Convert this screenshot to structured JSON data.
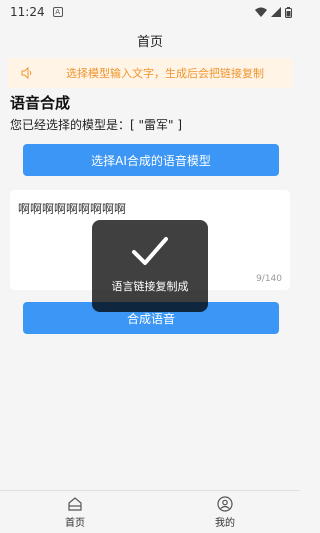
{
  "status_bar": {
    "time": "11:24",
    "notif_glyph": "A"
  },
  "nav": {
    "title": "首页"
  },
  "notice": {
    "icon": "speaker-icon",
    "text": "选择模型输入文字，生成后会把链接复制"
  },
  "main": {
    "title": "语音合成",
    "model_line": "您已经选择的模型是：[ \"雷军\" ]",
    "select_button": "选择AI合成的语音模型",
    "text_input": {
      "value": "啊啊啊啊啊啊啊啊啊",
      "counter": "9/140"
    },
    "synth_button": "合成语音"
  },
  "toast": {
    "icon": "check-icon",
    "message": "语言链接复制成"
  },
  "tabs": [
    {
      "label": "首页",
      "icon": "home-icon"
    },
    {
      "label": "我的",
      "icon": "user-icon"
    }
  ],
  "colors": {
    "primary": "#3b96f5",
    "notice_bg": "#fff4e6",
    "notice_text": "#f0952e"
  }
}
